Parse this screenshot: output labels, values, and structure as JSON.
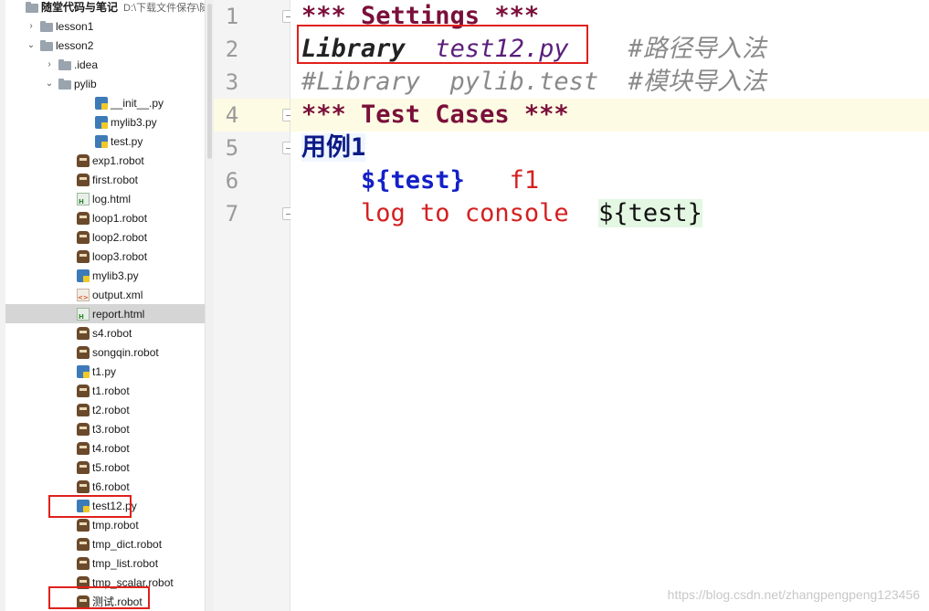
{
  "tree": {
    "root": {
      "label": "随堂代码与笔记",
      "path": "D:\\下载文件保存\\随"
    },
    "items": [
      {
        "label": "lesson1",
        "type": "folder",
        "arrow": "›"
      },
      {
        "label": "lesson2",
        "type": "folder",
        "arrow": "⌄"
      },
      {
        "label": ".idea",
        "type": "folder",
        "arrow": "›"
      },
      {
        "label": "pylib",
        "type": "folder",
        "arrow": "⌄"
      },
      {
        "label": "__init__.py",
        "type": "py"
      },
      {
        "label": "mylib3.py",
        "type": "py"
      },
      {
        "label": "test.py",
        "type": "py"
      },
      {
        "label": "exp1.robot",
        "type": "robot"
      },
      {
        "label": "first.robot",
        "type": "robot"
      },
      {
        "label": "log.html",
        "type": "html"
      },
      {
        "label": "loop1.robot",
        "type": "robot"
      },
      {
        "label": "loop2.robot",
        "type": "robot"
      },
      {
        "label": "loop3.robot",
        "type": "robot"
      },
      {
        "label": "mylib3.py",
        "type": "py"
      },
      {
        "label": "output.xml",
        "type": "xml"
      },
      {
        "label": "report.html",
        "type": "html",
        "selected": true
      },
      {
        "label": "s4.robot",
        "type": "robot"
      },
      {
        "label": "songqin.robot",
        "type": "robot"
      },
      {
        "label": "t1.py",
        "type": "py"
      },
      {
        "label": "t1.robot",
        "type": "robot"
      },
      {
        "label": "t2.robot",
        "type": "robot"
      },
      {
        "label": "t3.robot",
        "type": "robot"
      },
      {
        "label": "t4.robot",
        "type": "robot"
      },
      {
        "label": "t5.robot",
        "type": "robot"
      },
      {
        "label": "t6.robot",
        "type": "robot"
      },
      {
        "label": "test12.py",
        "type": "py",
        "highlighted": true
      },
      {
        "label": "tmp.robot",
        "type": "robot"
      },
      {
        "label": "tmp_dict.robot",
        "type": "robot"
      },
      {
        "label": "tmp_list.robot",
        "type": "robot"
      },
      {
        "label": "tmp_scalar.robot",
        "type": "robot"
      },
      {
        "label": "测试.robot",
        "type": "robot",
        "highlighted": true
      }
    ]
  },
  "editor": {
    "line_numbers": [
      "1",
      "2",
      "3",
      "4",
      "5",
      "6",
      "7"
    ],
    "current_line": 4,
    "lines": [
      [
        {
          "text": "*** Settings ***",
          "cls": "kw"
        }
      ],
      [
        {
          "text": "Library",
          "cls": "lib"
        },
        {
          "text": "  ",
          "cls": ""
        },
        {
          "text": "test12.py",
          "cls": "arg"
        },
        {
          "text": "    ",
          "cls": ""
        },
        {
          "text": "#路径导入法",
          "cls": "cmt"
        }
      ],
      [
        {
          "text": "#Library  pylib.test  #模块导入法",
          "cls": "cmt"
        }
      ],
      [
        {
          "text": "*** Test Cases ***",
          "cls": "kw"
        }
      ],
      [
        {
          "text": "用例1",
          "cls": "tc"
        }
      ],
      [
        {
          "text": "    ",
          "cls": ""
        },
        {
          "text": "${test}",
          "cls": "var"
        },
        {
          "text": "   ",
          "cls": ""
        },
        {
          "text": "f1",
          "cls": "num"
        }
      ],
      [
        {
          "text": "    ",
          "cls": ""
        },
        {
          "text": "log to console",
          "cls": "kwc"
        },
        {
          "text": "  ",
          "cls": ""
        },
        {
          "text": "${test}",
          "cls": "varbg"
        }
      ]
    ]
  },
  "watermark": "https://blog.csdn.net/zhangpengpeng123456"
}
